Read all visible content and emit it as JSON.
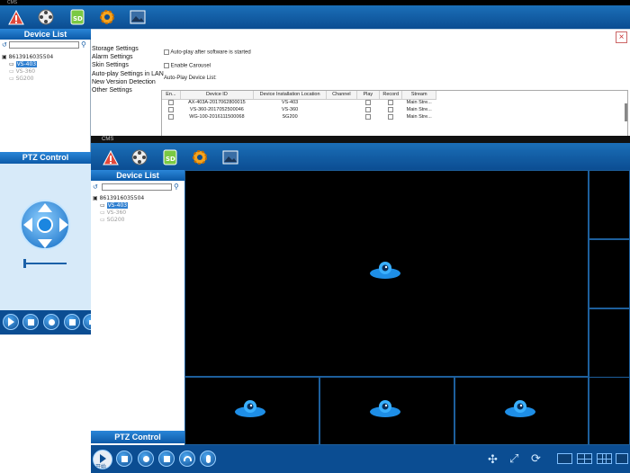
{
  "back_window": {
    "title": "CMS",
    "device_list_title": "Device List",
    "tree": {
      "root": "8613916035504",
      "items": [
        {
          "label": "VS-403",
          "selected": true
        },
        {
          "label": "VS-360",
          "selected": false
        },
        {
          "label": "SG200",
          "selected": false
        }
      ]
    },
    "settings_menu": [
      "Storage Settings",
      "Alarm Settings",
      "Skin Settings",
      "Auto-play Settings in LAN",
      "New Version Detection",
      "Other Settings"
    ],
    "autoplay_checkbox_label": "Auto-play after software is started",
    "carousel_checkbox_label": "Enable Carousel",
    "autoplay_list_label": "Auto-Play Device List:",
    "table": {
      "headers": [
        "En...",
        "Device ID",
        "Device Installation Location",
        "Channel",
        "Play",
        "Record",
        "Stream"
      ],
      "rows": [
        [
          "AX-403A-2017062800015",
          "VS-403",
          "Main Stre..."
        ],
        [
          "VS-360-2017052500046",
          "VS-360",
          "Main Stre..."
        ],
        [
          "WG-100-2016111500068",
          "SG200",
          "Main Stre..."
        ]
      ]
    },
    "ptz_title": "PTZ Control"
  },
  "front_window": {
    "title": "CMS",
    "device_list_title": "Device List",
    "tree": {
      "root": "8613916035504",
      "items": [
        {
          "label": "VS-403",
          "selected": true
        },
        {
          "label": "VS-360",
          "selected": false
        },
        {
          "label": "SG200",
          "selected": false
        }
      ]
    },
    "ptz_title": "PTZ Control",
    "start_label": "开始"
  },
  "colors": {
    "toolbar": "#0b4d92",
    "accent": "#2a86d8",
    "video_bg": "#000000",
    "grid_line": "#1d5f9c"
  },
  "icons": [
    "warning-icon",
    "film-reel-icon",
    "sd-card-icon",
    "gear-icon",
    "image-icon",
    "close-icon",
    "search-icon",
    "refresh-icon",
    "play-icon",
    "stop-icon",
    "record-icon",
    "microphone-icon",
    "headphones-icon",
    "camera-cloud-icon"
  ]
}
